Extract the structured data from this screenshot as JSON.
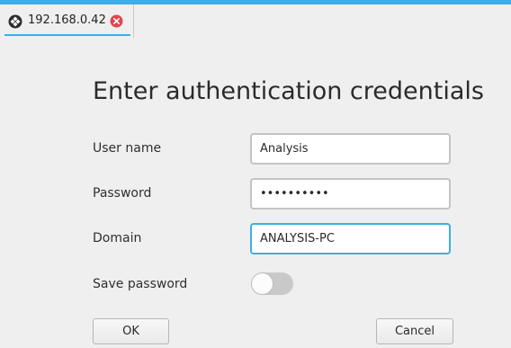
{
  "tab": {
    "title": "192.168.0.42",
    "icon": "remote-desktop-icon",
    "close_icon": "close-icon"
  },
  "dialog": {
    "heading": "Enter authentication credentials",
    "username_label": "User name",
    "username_value": "Analysis",
    "password_label": "Password",
    "password_value": "••••••••••",
    "domain_label": "Domain",
    "domain_value": "ANALYSIS-PC",
    "save_password_label": "Save password",
    "save_password_enabled": false,
    "ok_label": "OK",
    "cancel_label": "Cancel"
  },
  "colors": {
    "accent": "#3daee9",
    "close_red": "#e0464f"
  }
}
